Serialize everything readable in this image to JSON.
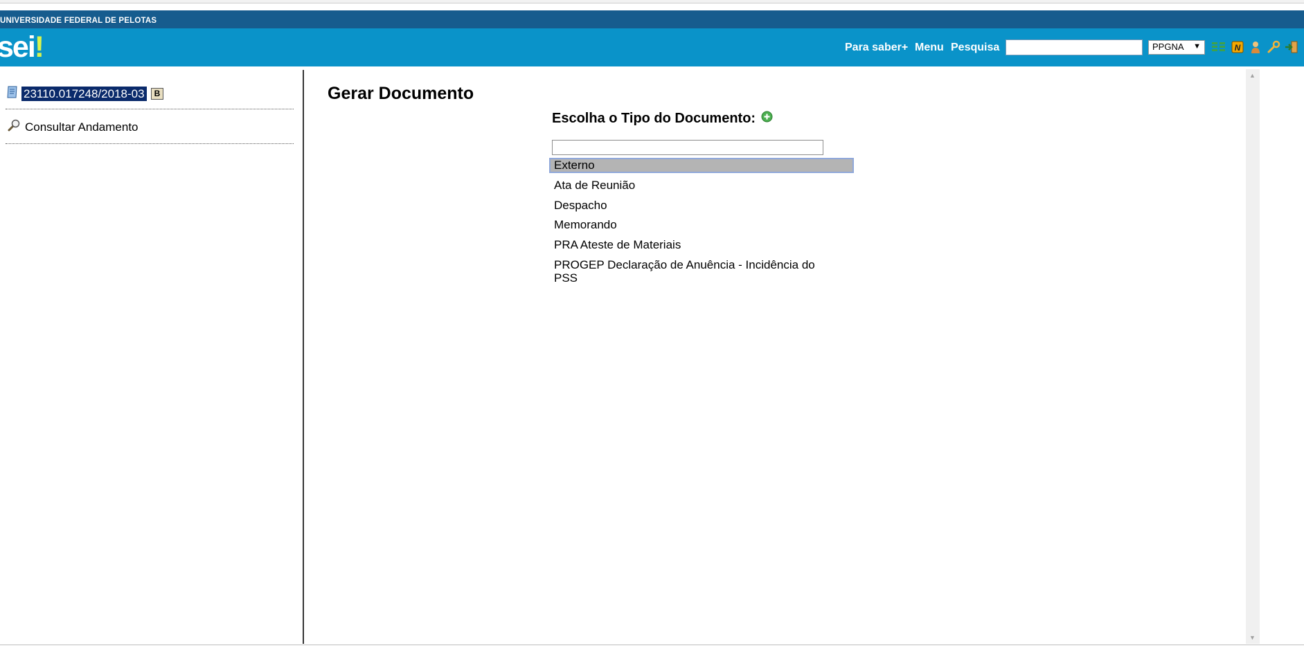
{
  "header": {
    "institution": "UNIVERSIDADE FEDERAL DE PELOTAS",
    "logo_text": "sei",
    "logo_mark": "!",
    "links": [
      "Para saber+",
      "Menu",
      "Pesquisa"
    ],
    "search_value": "",
    "unit_selected": "PPGNA",
    "icons": [
      "list-view-icon",
      "notice-n-icon",
      "user-icon",
      "wrench-icon",
      "exit-icon"
    ]
  },
  "sidebar": {
    "process_number": "23110.017248/2018-03",
    "process_badge": "B",
    "consult_link": "Consultar Andamento"
  },
  "main": {
    "title": "Gerar Documento",
    "choose_label": "Escolha o Tipo do Documento:",
    "filter_value": "",
    "document_types": [
      "Externo",
      "Ata de Reunião",
      "Despacho",
      "Memorando",
      "PRA Ateste de Materiais",
      "PROGEP Declaração de Anuência - Incidência do PSS"
    ],
    "selected_index": 0
  },
  "colors": {
    "header_dark": "#165c8e",
    "header_blue": "#0a93c9",
    "logo_accent": "#d9f34d",
    "process_highlight": "#0a2a6b",
    "selected_option": "#b4b4b4"
  }
}
